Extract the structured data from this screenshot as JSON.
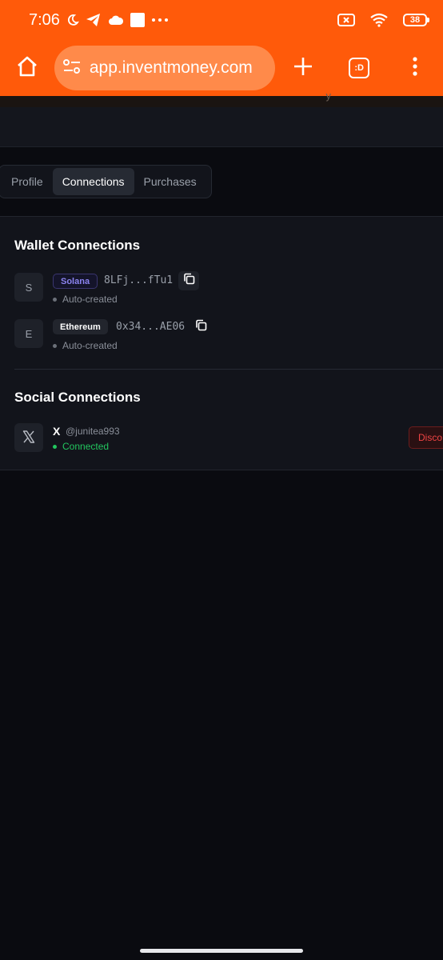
{
  "status_bar": {
    "time": "7:06",
    "battery": "38",
    "icons": [
      "moon-icon",
      "telegram-icon",
      "cloud-icon",
      "square-icon",
      "more-dots-icon",
      "no-sim-icon",
      "wifi-icon",
      "battery-icon"
    ]
  },
  "browser": {
    "url": "app.inventmoney.com",
    "tab_count": ":D",
    "accent": "#ff5a0a"
  },
  "strip_text": "y",
  "tabs": [
    {
      "label": "Profile",
      "active": false
    },
    {
      "label": "Connections",
      "active": true
    },
    {
      "label": "Purchases",
      "active": false
    }
  ],
  "wallets": {
    "title": "Wallet Connections",
    "items": [
      {
        "avatar": "S",
        "chain": "Solana",
        "address": "8LFj...fTu1",
        "status": "Auto-created"
      },
      {
        "avatar": "E",
        "chain": "Ethereum",
        "address": "0x34...AE06",
        "status": "Auto-created"
      }
    ]
  },
  "social": {
    "title": "Social Connections",
    "items": [
      {
        "platform": "X",
        "handle": "@junitea993",
        "status": "Connected",
        "action": "Disco"
      }
    ]
  },
  "colors": {
    "background": "#0a0b10",
    "card": "#12141b",
    "connected": "#22c55e",
    "danger": "#ef4444",
    "solana": "#8b83f0"
  }
}
